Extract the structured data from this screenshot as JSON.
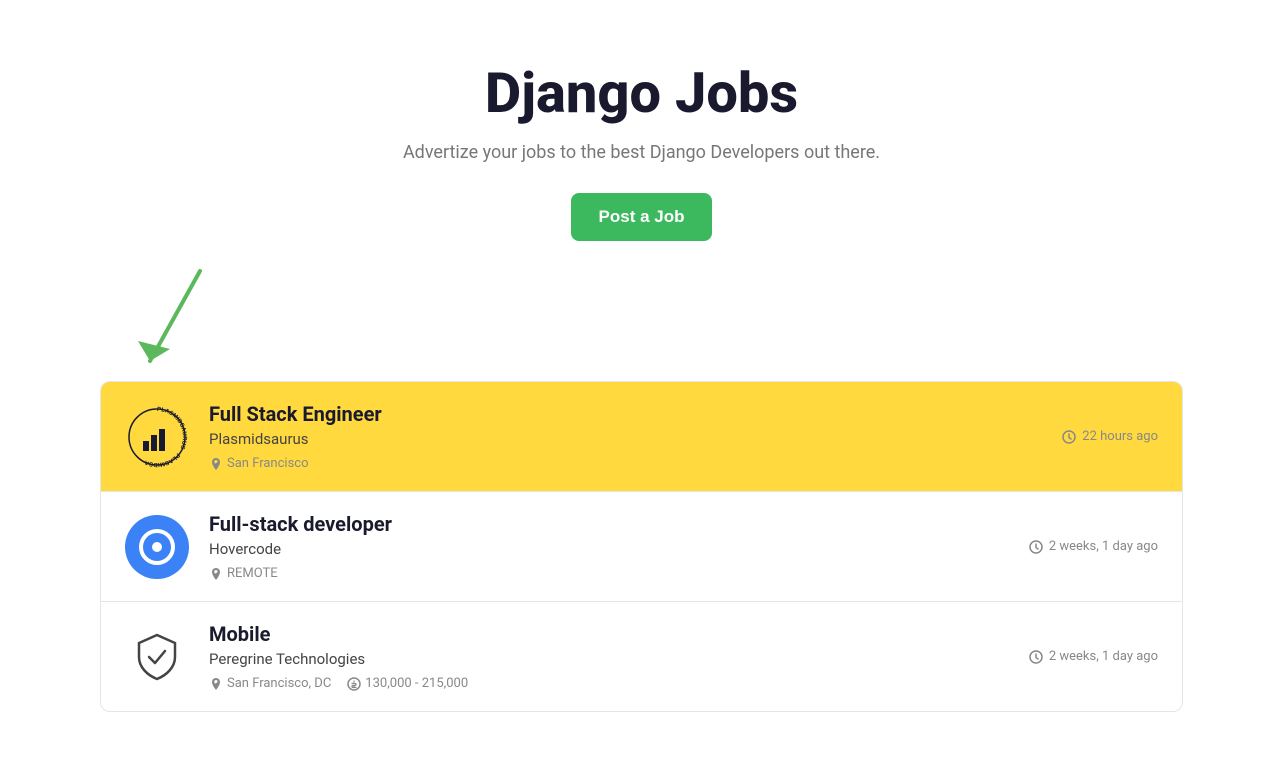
{
  "page": {
    "title": "Django Jobs",
    "subtitle": "Advertize your jobs to the best Django Developers out there.",
    "post_job_label": "Post a Job"
  },
  "jobs": [
    {
      "id": 1,
      "title": "Full Stack Engineer",
      "company": "Plasmidsaurus",
      "location": "San Francisco",
      "location_type": "city",
      "salary": null,
      "time_ago": "22 hours ago",
      "featured": true,
      "logo_type": "plasmidsaurus"
    },
    {
      "id": 2,
      "title": "Full-stack developer",
      "company": "Hovercode",
      "location": "REMOTE",
      "location_type": "remote",
      "salary": null,
      "time_ago": "2 weeks, 1 day ago",
      "featured": false,
      "logo_type": "hovercode"
    },
    {
      "id": 3,
      "title": "Mobile",
      "company": "Peregrine Technologies",
      "location": "San Francisco, DC",
      "location_type": "city",
      "salary": "130,000 - 215,000",
      "time_ago": "2 weeks, 1 day ago",
      "featured": false,
      "logo_type": "peregrine"
    }
  ]
}
